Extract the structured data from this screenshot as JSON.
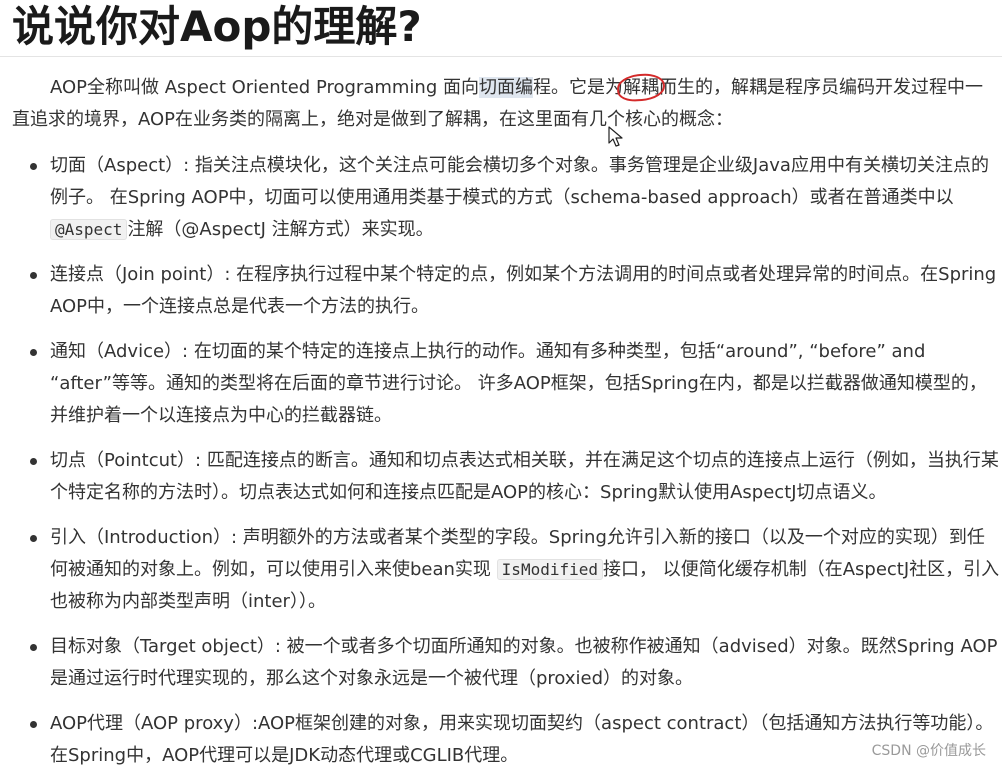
{
  "title": "说说你对Aop的理解?",
  "intro": {
    "p1": "AOP全称叫做 Aspect Oriented Programming  面向",
    "p1_highlight": "切面编",
    "p2": "程。它是为",
    "p2_circled": "解耦",
    "p3": "而生的，解耦是程序员编码开发过程中一直追求的境界，AOP在业务类的隔离上，绝对是做到了解耦，在这里面有几个核心的概念："
  },
  "concepts": [
    {
      "before": "切面（Aspect）: 指关注点模块化，这个关注点可能会横切多个对象。事务管理是企业级Java应用中有关横切关注点的例子。 在Spring AOP中，切面可以使用通用类基于模式的方式（schema-based approach）或者在普通类中以",
      "code": "@Aspect",
      "after": "注解（@AspectJ 注解方式）来实现。"
    },
    {
      "before": "连接点（Join point）: 在程序执行过程中某个特定的点，例如某个方法调用的时间点或者处理异常的时间点。在Spring AOP中，一个连接点总是代表一个方法的执行。",
      "code": "",
      "after": ""
    },
    {
      "before": "通知（Advice）: 在切面的某个特定的连接点上执行的动作。通知有多种类型，包括“around”, “before” and “after”等等。通知的类型将在后面的章节进行讨论。 许多AOP框架，包括Spring在内，都是以拦截器做通知模型的，并维护着一个以连接点为中心的拦截器链。",
      "code": "",
      "after": ""
    },
    {
      "before": "切点（Pointcut）: 匹配连接点的断言。通知和切点表达式相关联，并在满足这个切点的连接点上运行（例如，当执行某个特定名称的方法时）。切点表达式如何和连接点匹配是AOP的核心：Spring默认使用AspectJ切点语义。",
      "code": "",
      "after": ""
    },
    {
      "before": "引入（Introduction）: 声明额外的方法或者某个类型的字段。Spring允许引入新的接口（以及一个对应的实现）到任何被通知的对象上。例如，可以使用引入来使bean实现 ",
      "code": "IsModified",
      "after": "接口， 以便简化缓存机制（在AspectJ社区，引入也被称为内部类型声明（inter））。"
    },
    {
      "before": "目标对象（Target object）: 被一个或者多个切面所通知的对象。也被称作被通知（advised）对象。既然Spring AOP是通过运行时代理实现的，那么这个对象永远是一个被代理（proxied）的对象。",
      "code": "",
      "after": ""
    },
    {
      "before": "AOP代理（AOP proxy）:AOP框架创建的对象，用来实现切面契约（aspect contract）（包括通知方法执行等功能）。在Spring中，AOP代理可以是JDK动态代理或CGLIB代理。",
      "code": "",
      "after": ""
    }
  ],
  "watermark": "CSDN @价值成长",
  "colors": {
    "text": "#333333",
    "highlight": "#dfe6ef",
    "circle": "#d42a2a"
  }
}
